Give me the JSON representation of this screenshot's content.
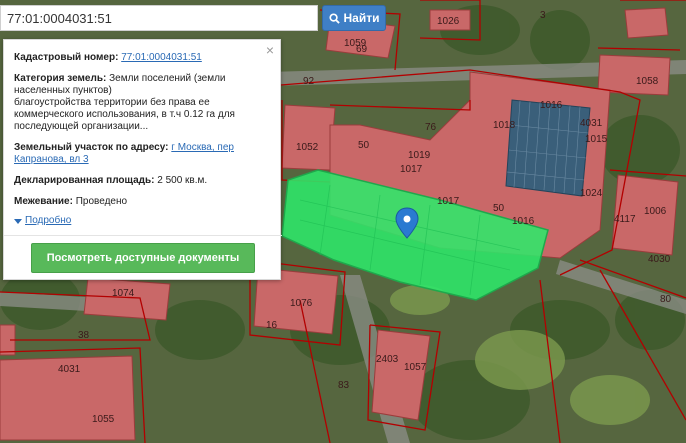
{
  "search": {
    "value": "77:01:0004031:51",
    "button_label": "Найти",
    "icon": "search-icon"
  },
  "popup": {
    "close_label": "×",
    "cadastral_label": "Кадастровый номер:",
    "cadastral_value": "77:01:0004031:51",
    "category_label": "Категория земель:",
    "category_value": "Земли поселений (земли населенных пунктов)",
    "category_desc": "благоустройства территории без права ее коммерческого использования, в т.ч 0.12 га для последующей организации...",
    "address_label": "Земельный участок по адресу:",
    "address_value": "г Москва, пер Капранова, вл 3",
    "area_label": "Декларированная площадь:",
    "area_value": "2 500 кв.м.",
    "survey_label": "Межевание:",
    "survey_value": "Проведено",
    "more_label": "Подробно",
    "docs_button": "Посмотреть доступные документы"
  },
  "map": {
    "labels": [
      "1026",
      "3",
      "1059",
      "69",
      "1058",
      "92",
      "1016",
      "76",
      "4031",
      "1018",
      "1015",
      "1052",
      "50",
      "1017",
      "1019",
      "1024",
      "1016",
      "50",
      "4117",
      "1006",
      "4030",
      "1017",
      "1074",
      "1076",
      "16",
      "38",
      "2403",
      "1057",
      "4031",
      "1055",
      "83",
      "80"
    ],
    "colors": {
      "parcel": "#2ee86a",
      "building": "#c96868",
      "boundary": "#b30000",
      "marker": "#2a7ad1"
    }
  }
}
